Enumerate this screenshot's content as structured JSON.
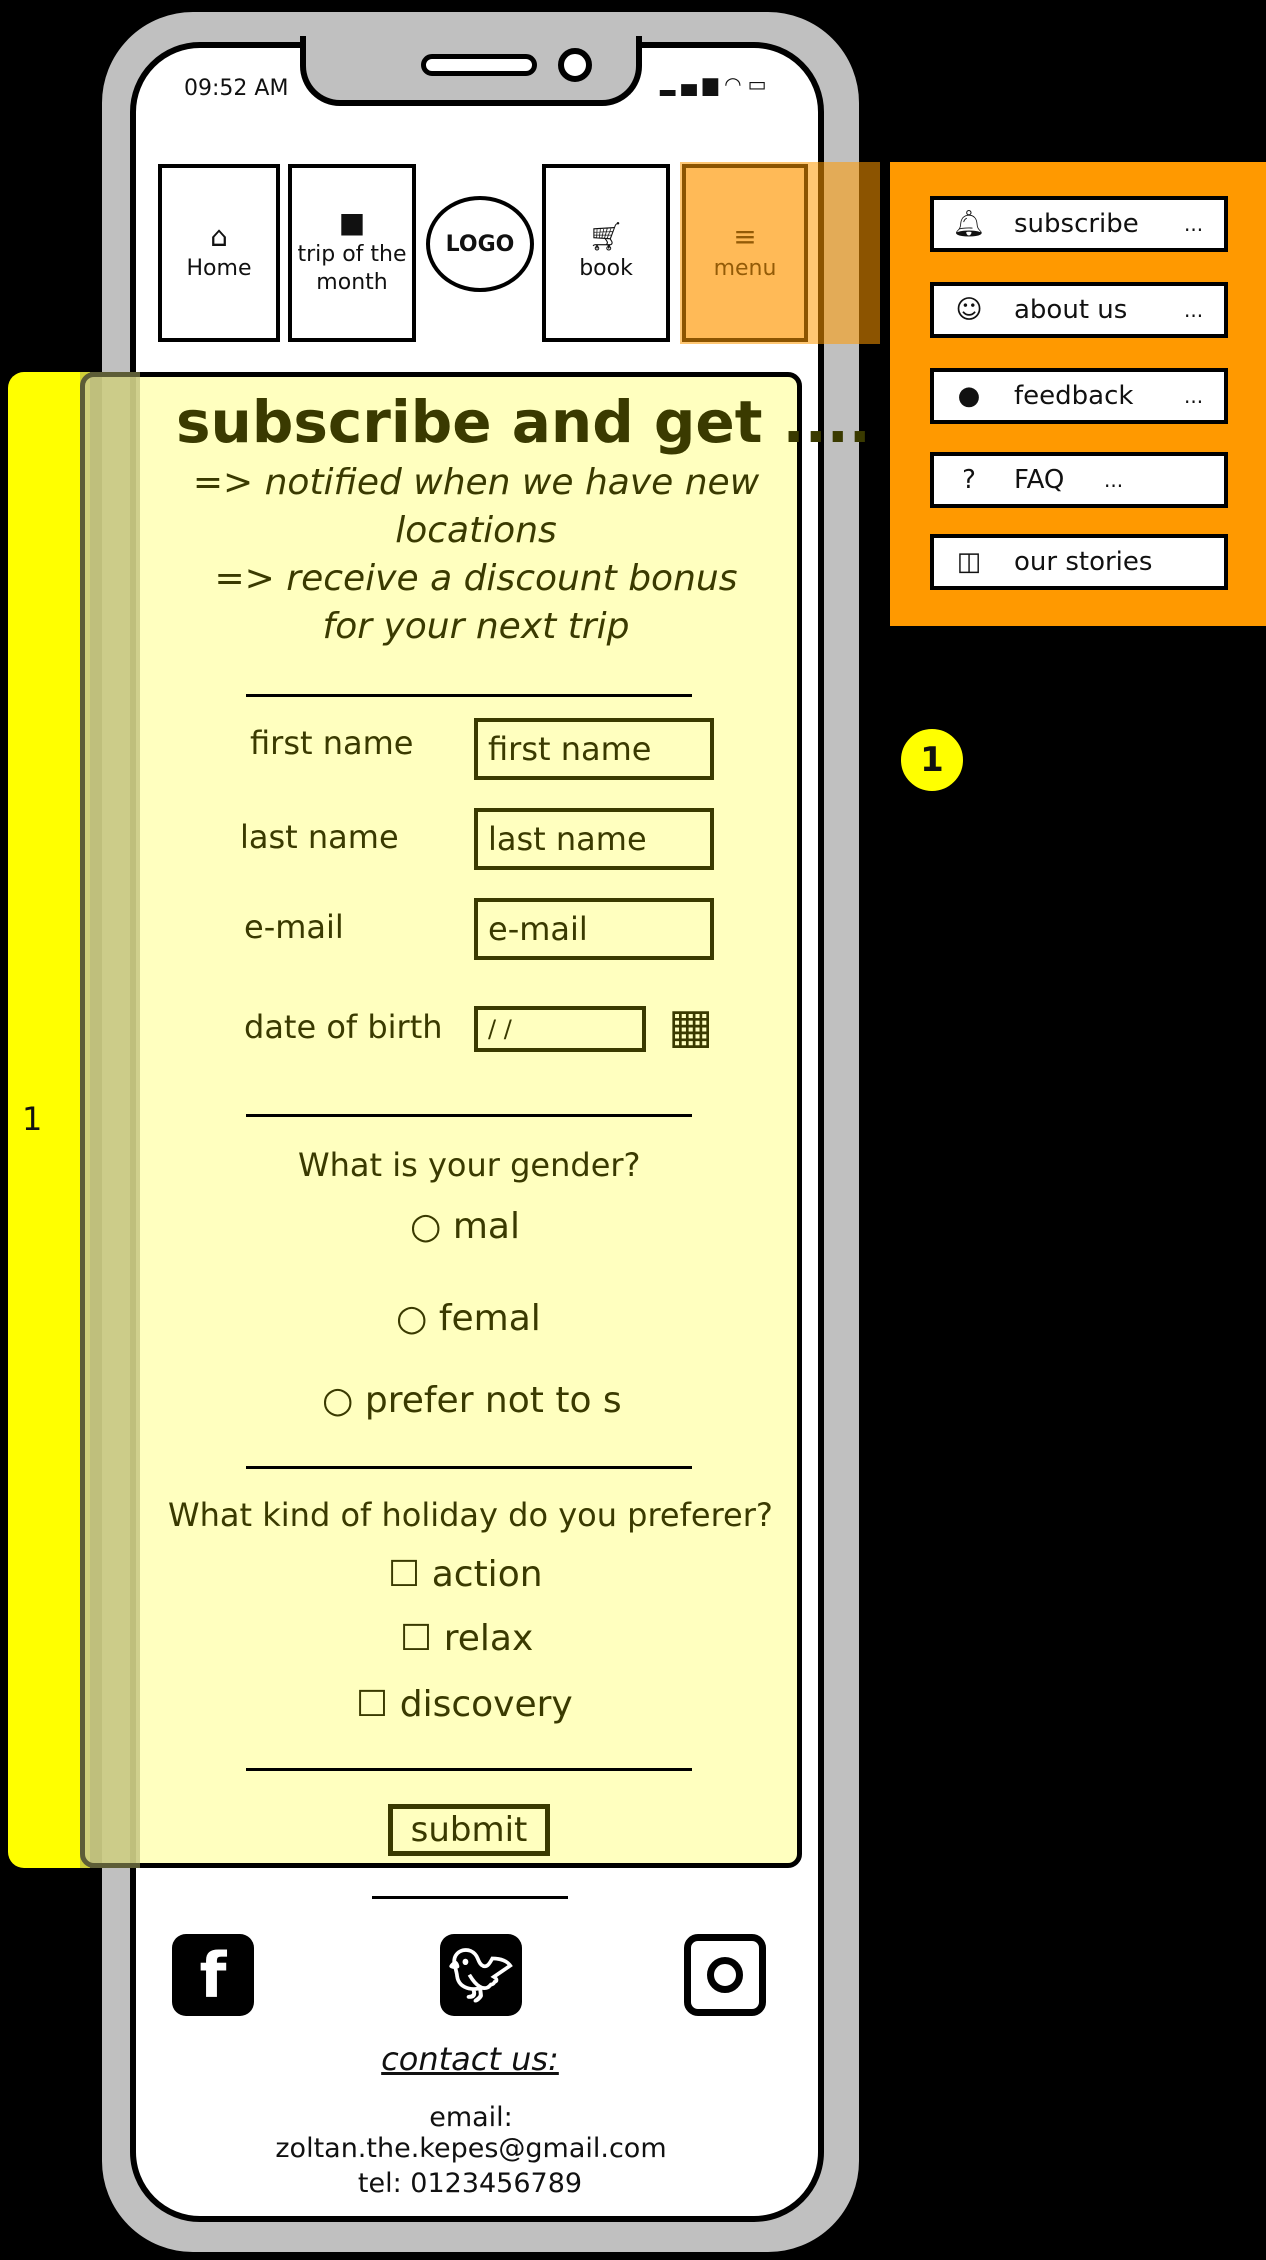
{
  "status_bar": {
    "time": "09:52 AM"
  },
  "nav": {
    "home": "Home",
    "trip": "trip of the month",
    "logo": "LOGO",
    "book": "book",
    "menu": "menu"
  },
  "dropdown": [
    {
      "icon": "bell-icon",
      "label": "subscribe",
      "dots": "..."
    },
    {
      "icon": "smiley-icon",
      "label": "about us",
      "dots": "..."
    },
    {
      "icon": "speech-bubble-icon",
      "label": "feedback",
      "dots": "..."
    },
    {
      "icon": "question-icon",
      "label": "FAQ",
      "dots": "..."
    },
    {
      "icon": "stories-icon",
      "label": "our stories",
      "dots": ""
    }
  ],
  "annotation": {
    "strip_label": "1",
    "badge": "1"
  },
  "form": {
    "title": "subscribe and get ....",
    "line1": "=> notified when we have new",
    "line2": "locations",
    "line3": "=> receive  a discount bonus",
    "line4": "for your next trip",
    "fields": [
      {
        "label": "first name",
        "value": "first name"
      },
      {
        "label": "last name",
        "value": "last name"
      },
      {
        "label": "e-mail",
        "value": "e-mail"
      },
      {
        "label": "date of birth",
        "value": " / /"
      }
    ],
    "gender_question": "What is your gender?",
    "gender_options": [
      "○ mal",
      "○ femal",
      "○ prefer not to s"
    ],
    "holiday_question": "What kind of holiday do you preferer?",
    "holiday_options": [
      "☐ action",
      "☐ relax",
      "☐ discovery"
    ],
    "submit": "submit"
  },
  "footer": {
    "contact_title": "contact us:",
    "email": "email: zoltan.the.kepes@gmail.com",
    "tel": "tel: 0123456789"
  }
}
